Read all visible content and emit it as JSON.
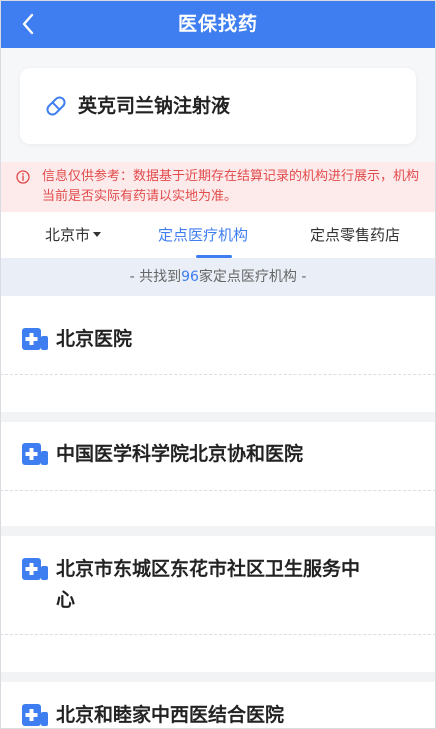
{
  "header": {
    "title": "医保找药",
    "back_icon": "chevron-left-icon"
  },
  "drug": {
    "name": "英克司兰钠注射液",
    "icon": "pill-icon"
  },
  "notice": {
    "icon": "info-circle-icon",
    "text": "信息仅供参考：数据基于近期存在结算记录的机构进行展示，机构当前是否实际有药请以实地为准。"
  },
  "tabs": {
    "city": "北京市",
    "hospital": "定点医疗机构",
    "pharmacy": "定点零售药店",
    "active": "hospital"
  },
  "result": {
    "prefix": "- 共找到",
    "count": "96",
    "suffix": "家定点医疗机构 -"
  },
  "hospitals": [
    {
      "name": "北京医院"
    },
    {
      "name": "中国医学科学院北京协和医院"
    },
    {
      "name": "北京市东城区东花市社区卫生服务中心"
    },
    {
      "name": "北京和睦家中西医结合医院"
    }
  ],
  "colors": {
    "primary": "#3f7ef0",
    "notice_bg": "#fdebec",
    "notice_text": "#e24b4b",
    "result_bg": "#e9eef7"
  }
}
